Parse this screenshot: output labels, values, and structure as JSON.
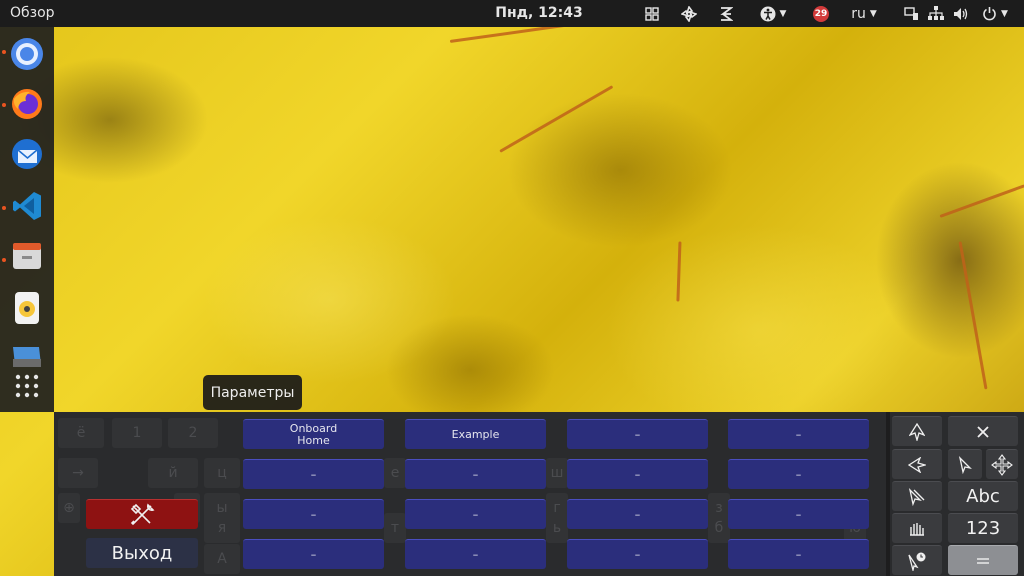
{
  "topbar": {
    "activities": "Обзор",
    "clock": "Пнд, 12:43",
    "notification_count": "29",
    "language": "ru"
  },
  "dock": {
    "apps": [
      "chromium-icon",
      "firefox-icon",
      "thunderbird-icon",
      "vscode-icon",
      "files-icon",
      "rhythmbox-icon",
      "install-icon",
      "show-apps-icon"
    ]
  },
  "tooltip": {
    "text": "Параметры"
  },
  "keyboard": {
    "faint_keys_row1": [
      "ё",
      "1",
      "2"
    ],
    "faint_keys_row2": [
      "й",
      "ц",
      "е",
      "ш"
    ],
    "faint_keys_row3": [
      "ф",
      "ы",
      "г",
      "з"
    ],
    "faint_keys_row4": [
      "я",
      "т",
      "ь",
      "б",
      "ю"
    ],
    "faint_keys_row5": [
      "А"
    ],
    "snippets": [
      [
        "Onboard\nHome",
        "Example",
        "–",
        "–"
      ],
      [
        "–",
        "–",
        "–",
        "–"
      ],
      [
        "–",
        "–",
        "–",
        "–"
      ],
      [
        "–",
        "–",
        "–",
        "–"
      ]
    ],
    "exit_label": "Выход",
    "abc_label": "Abc",
    "numbers_label": "123"
  },
  "colors": {
    "snippet_bg": "#2b2e7c",
    "settings_bg": "#8e1212",
    "topbar_bg": "#1c1c1c"
  }
}
